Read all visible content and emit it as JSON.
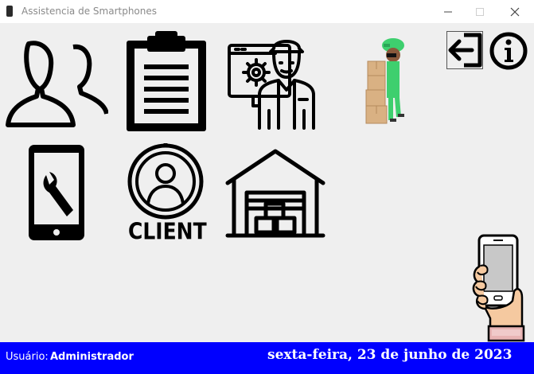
{
  "window": {
    "title": "Assistencia de Smartphones",
    "icon": "smartphone-icon",
    "controls": [
      "minimize-icon",
      "maximize-icon",
      "close-icon"
    ]
  },
  "menu": {
    "tiles": [
      {
        "name": "users",
        "icon": "users-icon"
      },
      {
        "name": "clipboard",
        "icon": "clipboard-icon"
      },
      {
        "name": "technician",
        "icon": "technician-icon"
      },
      {
        "name": "delivery",
        "icon": "delivery-person-icon"
      },
      {
        "name": "repair",
        "icon": "phone-repair-icon"
      },
      {
        "name": "client",
        "icon": "client-icon",
        "label": "CLIENT"
      },
      {
        "name": "warehouse",
        "icon": "warehouse-icon"
      }
    ],
    "logout_icon": "logout-icon",
    "info_icon": "info-icon",
    "decoration_icon": "hand-holding-phone-icon"
  },
  "status": {
    "user_label": "Usuário:",
    "user_name": "Administrador",
    "date": "sexta-feira, 23 de junho de 2023"
  },
  "colors": {
    "status_bar": "#0000ff",
    "status_text": "#ffffff",
    "background": "#efefef",
    "icon_stroke": "#000000",
    "delivery_green": "#3ecf6e",
    "box_tan": "#d9b183"
  }
}
